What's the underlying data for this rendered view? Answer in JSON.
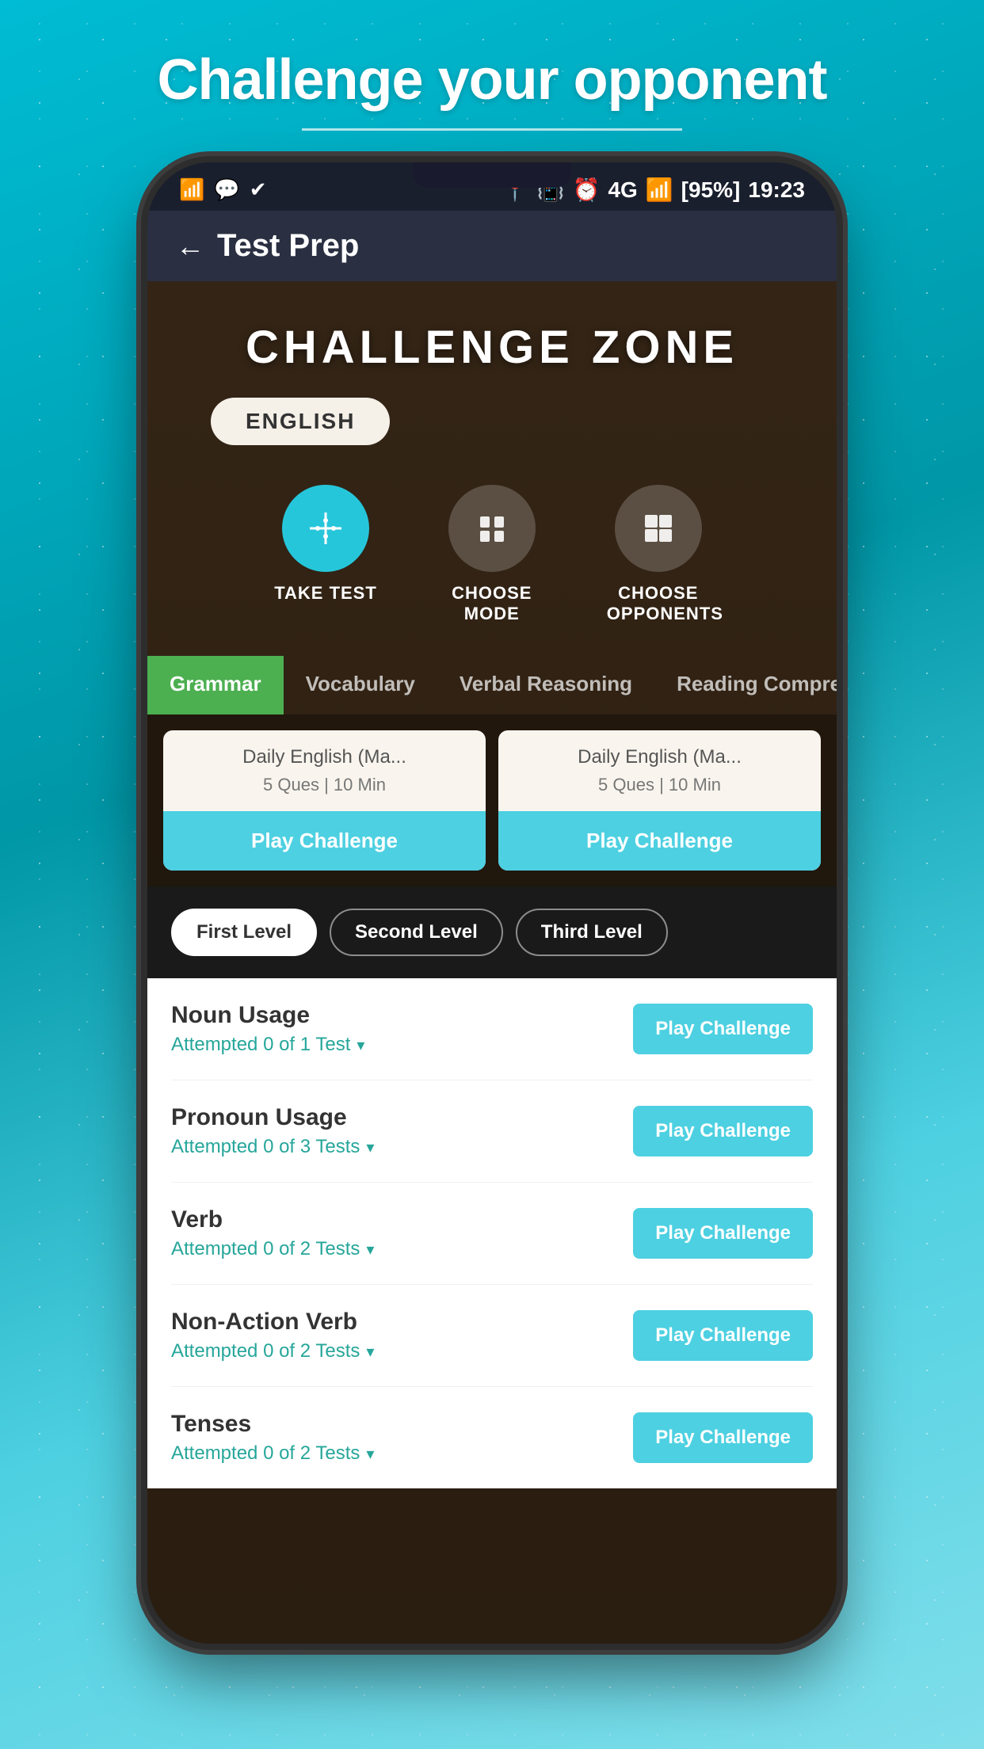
{
  "page": {
    "title": "Challenge your opponent",
    "divider": true
  },
  "status_bar": {
    "time": "19:23",
    "battery": "95%",
    "signal": "4G"
  },
  "app_header": {
    "title": "Test Prep",
    "back_label": "←"
  },
  "challenge_zone": {
    "title": "CHALLENGE ZONE",
    "language_pill": "ENGLISH"
  },
  "mode_icons": [
    {
      "id": "take-test",
      "label": "TAKE TEST",
      "icon": "⊕",
      "active": true
    },
    {
      "id": "choose-mode",
      "label": "CHOOSE MODE",
      "icon": "📋",
      "active": false
    },
    {
      "id": "choose-opponents",
      "label": "CHOOSE OPPONENTS",
      "icon": "⊞",
      "active": false
    }
  ],
  "tabs": [
    {
      "id": "grammar",
      "label": "Grammar",
      "active": true
    },
    {
      "id": "vocabulary",
      "label": "Vocabulary",
      "active": false
    },
    {
      "id": "verbal-reasoning",
      "label": "Verbal Reasoning",
      "active": false
    },
    {
      "id": "reading-comp",
      "label": "Reading Compreh...",
      "active": false
    }
  ],
  "challenge_cards": [
    {
      "title": "Daily English (Ma...",
      "meta": "5 Ques | 10 Min",
      "button": "Play Challenge"
    },
    {
      "title": "Daily English (Ma...",
      "meta": "5 Ques | 10 Min",
      "button": "Play Challenge"
    }
  ],
  "levels": [
    {
      "id": "first-level",
      "label": "First Level",
      "active": true
    },
    {
      "id": "second-level",
      "label": "Second Level",
      "active": false
    },
    {
      "id": "third-level",
      "label": "Third Level",
      "active": false
    }
  ],
  "list_items": [
    {
      "name": "Noun Usage",
      "attempted": "Attempted 0 of 1 Test",
      "button": "Play Challenge"
    },
    {
      "name": "Pronoun Usage",
      "attempted": "Attempted 0 of 3 Tests",
      "button": "Play Challenge"
    },
    {
      "name": "Verb",
      "attempted": "Attempted 0 of 2 Tests",
      "button": "Play Challenge"
    },
    {
      "name": "Non-Action Verb",
      "attempted": "Attempted 0 of 2 Tests",
      "button": "Play Challenge"
    },
    {
      "name": "Tenses",
      "attempted": "Attempted 0 of 2 Tests",
      "button": "Play Challenge"
    }
  ],
  "icons": {
    "filter": "⊕",
    "doc": "📄",
    "grid": "⊞",
    "back": "←",
    "chevron_down": "▾"
  }
}
